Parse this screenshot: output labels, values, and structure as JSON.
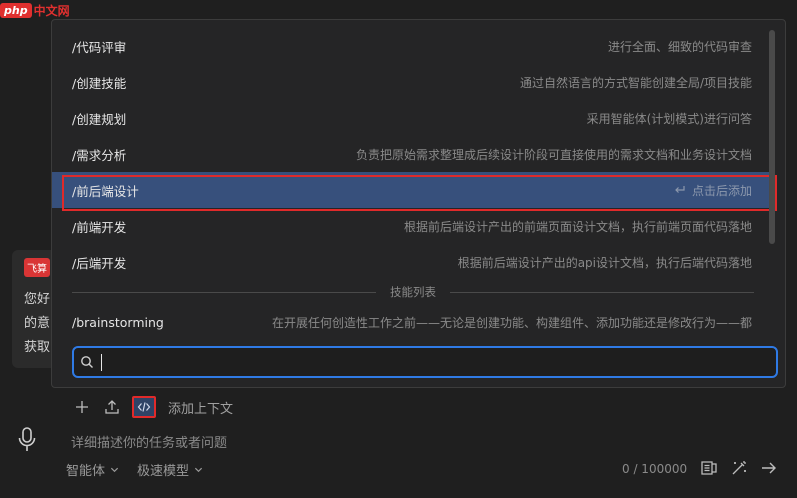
{
  "watermark": {
    "logo": "php",
    "text": "中文网"
  },
  "chat": {
    "badge": "飞算",
    "lines": [
      "您好",
      "的意",
      "获取"
    ]
  },
  "commands": [
    {
      "name": "/代码评审",
      "desc": "进行全面、细致的代码审查"
    },
    {
      "name": "/创建技能",
      "desc": "通过自然语言的方式智能创建全局/项目技能"
    },
    {
      "name": "/创建规划",
      "desc": "采用智能体(计划模式)进行问答"
    },
    {
      "name": "/需求分析",
      "desc": "负责把原始需求整理成后续设计阶段可直接使用的需求文档和业务设计文档"
    },
    {
      "name": "/前后端设计",
      "desc": "点击后添加",
      "active": true
    },
    {
      "name": "/前端开发",
      "desc": "根据前后端设计产出的前端页面设计文档，执行前端页面代码落地"
    },
    {
      "name": "/后端开发",
      "desc": "根据前后端设计产出的api设计文档，执行后端代码落地"
    }
  ],
  "skills_divider": "技能列表",
  "skills": [
    {
      "name": "/brainstorming",
      "desc": "在开展任何创造性工作之前——无论是创建功能、构建组件、添加功能还是修改行为——都"
    }
  ],
  "search": {
    "value": "",
    "placeholder": ""
  },
  "toolbar": {
    "add_context_label": "添加上下文"
  },
  "prompt": {
    "placeholder": "详细描述你的任务或者问题",
    "value": ""
  },
  "bottom": {
    "mode_label": "智能体",
    "model_label": "极速模型",
    "counter": "0 / 100000"
  },
  "colors": {
    "accent": "#2f7ae5",
    "active_row": "#37507c",
    "highlight_outline": "#e02a2a"
  }
}
